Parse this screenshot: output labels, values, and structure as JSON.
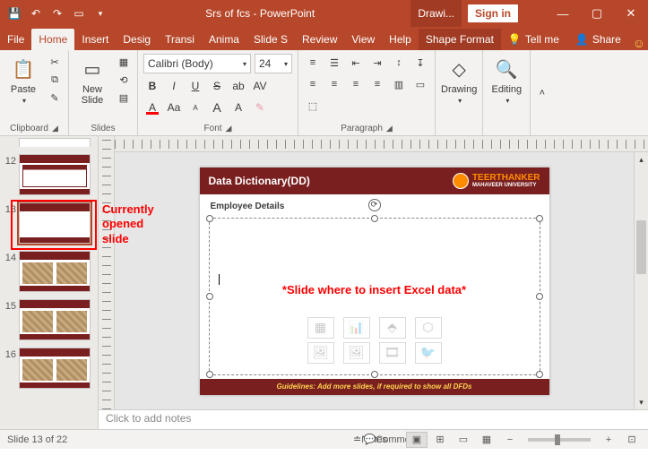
{
  "titlebar": {
    "title": "Srs of fcs  -  PowerPoint",
    "drawing": "Drawi...",
    "signin": "Sign in"
  },
  "tabs": {
    "file": "File",
    "home": "Home",
    "insert": "Insert",
    "design": "Desig",
    "transitions": "Transi",
    "animations": "Anima",
    "slideshow": "Slide S",
    "review": "Review",
    "view": "View",
    "help": "Help",
    "shapeformat": "Shape Format",
    "tellme": "Tell me",
    "share": "Share"
  },
  "ribbon": {
    "clipboard": {
      "label": "Clipboard",
      "paste": "Paste"
    },
    "slides": {
      "label": "Slides",
      "newslide": "New\nSlide"
    },
    "font": {
      "label": "Font",
      "name": "Calibri (Body)",
      "size": "24"
    },
    "paragraph": {
      "label": "Paragraph"
    },
    "drawing": {
      "label": "Drawing",
      "btn": "Drawing"
    },
    "editing": {
      "label": "Editing",
      "btn": "Editing"
    }
  },
  "thumbs": {
    "n12": "12",
    "n13": "13",
    "n14": "14",
    "n15": "15",
    "n16": "16"
  },
  "annotation": {
    "current": "Currently\nopened\nslide"
  },
  "slide": {
    "title": "Data Dictionary(DD)",
    "university_big": "TEERTHANKER",
    "university_small": "MAHAVEER UNIVERSITY",
    "employee": "Employee Details",
    "excel_note": "*Slide where to insert Excel data*",
    "footer": "Guidelines: Add more slides, if required to show all DFDs"
  },
  "notes": {
    "placeholder": "Click to add notes"
  },
  "status": {
    "slide": "Slide 13 of 22",
    "notes": "Notes",
    "comments": "Comments",
    "zoom": "- -"
  }
}
